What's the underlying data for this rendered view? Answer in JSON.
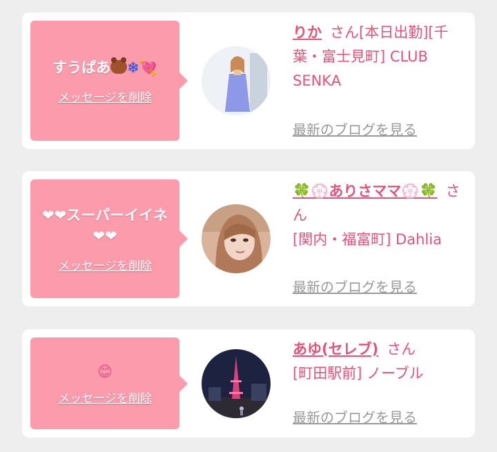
{
  "cards": [
    {
      "message_text": "すうぱあ",
      "message_emoji": "🐻❄💘",
      "delete_label": "メッセージを削除",
      "cast_name": "りか",
      "san": "さん",
      "shop_info": "[本日出勤][千葉・富士見町] CLUB SENKA",
      "blog_label": "最新のブログを見る",
      "avatar_icon": "woman-in-blue-dress-photo"
    },
    {
      "message_text": "❤❤スーパーイイネ❤❤",
      "delete_label": "メッセージを削除",
      "cast_name_prefix": "🍀💮",
      "cast_name": "ありさママ",
      "cast_name_suffix": "💮🍀",
      "san": "さん",
      "shop_info": "[関内・福富町] Dahlia",
      "blog_label": "最新のブログを見る",
      "avatar_icon": "woman-selfie-photo"
    },
    {
      "message_text": "😊",
      "delete_label": "メッセージを削除",
      "cast_name": "あゆ(セレブ)",
      "san": "さん",
      "shop_info": "[町田駅前] ノーブル",
      "blog_label": "最新のブログを見る",
      "avatar_icon": "tokyo-tower-night-photo"
    }
  ],
  "colors": {
    "bubble": "#fb9bab",
    "accent": "#e05478",
    "link_gray": "#999999",
    "page_bg": "#eeeeee"
  }
}
